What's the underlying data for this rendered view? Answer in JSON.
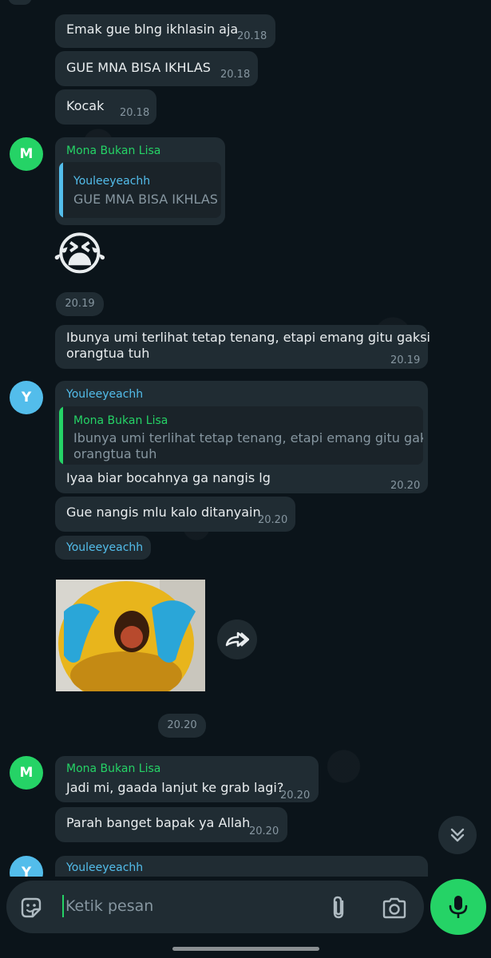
{
  "messages": {
    "m1": {
      "text": "Emak gue blng ikhlasin aja",
      "time": "20.18"
    },
    "m2": {
      "text": "GUE MNA BISA IKHLAS",
      "time": "20.18"
    },
    "m3": {
      "text": "Kocak",
      "time": "20.18"
    },
    "m4": {
      "sender": "Mona Bukan Lisa",
      "avatar": "M",
      "quote_name": "Youleeyeachh",
      "quote_text": "GUE MNA BISA IKHLAS"
    },
    "m5": {
      "emoji": "😭",
      "time": "20.19"
    },
    "m6": {
      "line1": "Ibunya umi terlihat tetap tenang, etapi emang gitu gaksi",
      "line2": "orangtua tuh",
      "time": "20.19"
    },
    "m7": {
      "sender": "Youleeyeachh",
      "avatar": "Y",
      "quote_name": "Mona Bukan Lisa",
      "quote_line1": "Ibunya umi terlihat tetap tenang, etapi emang gitu gaksi",
      "quote_line2": "orangtua tuh",
      "text": "Iyaa biar bocahnya ga nangis lg",
      "time": "20.20"
    },
    "m8": {
      "text": "Gue nangis mlu kalo ditanyain",
      "time": "20.20"
    },
    "m9": {
      "sender": "Youleeyeachh",
      "time": "20.20"
    },
    "m10": {
      "sender": "Mona Bukan Lisa",
      "avatar": "M",
      "text": "Jadi mi, gaada lanjut ke grab lagi?",
      "time": "20.20"
    },
    "m11": {
      "text": "Parah banget bapak ya Allah",
      "time": "20.20"
    },
    "m12": {
      "sender": "Youleeyeachh",
      "avatar": "Y"
    }
  },
  "composer": {
    "placeholder": "Ketik pesan"
  },
  "icons": [
    "sticker-icon",
    "attach-icon",
    "camera-icon",
    "mic-icon",
    "forward-icon",
    "scroll-down-icon"
  ],
  "colors": {
    "accent": "#25d366",
    "bubble": "#202c33",
    "background": "#0b141a",
    "name_blue": "#53bdeb"
  }
}
